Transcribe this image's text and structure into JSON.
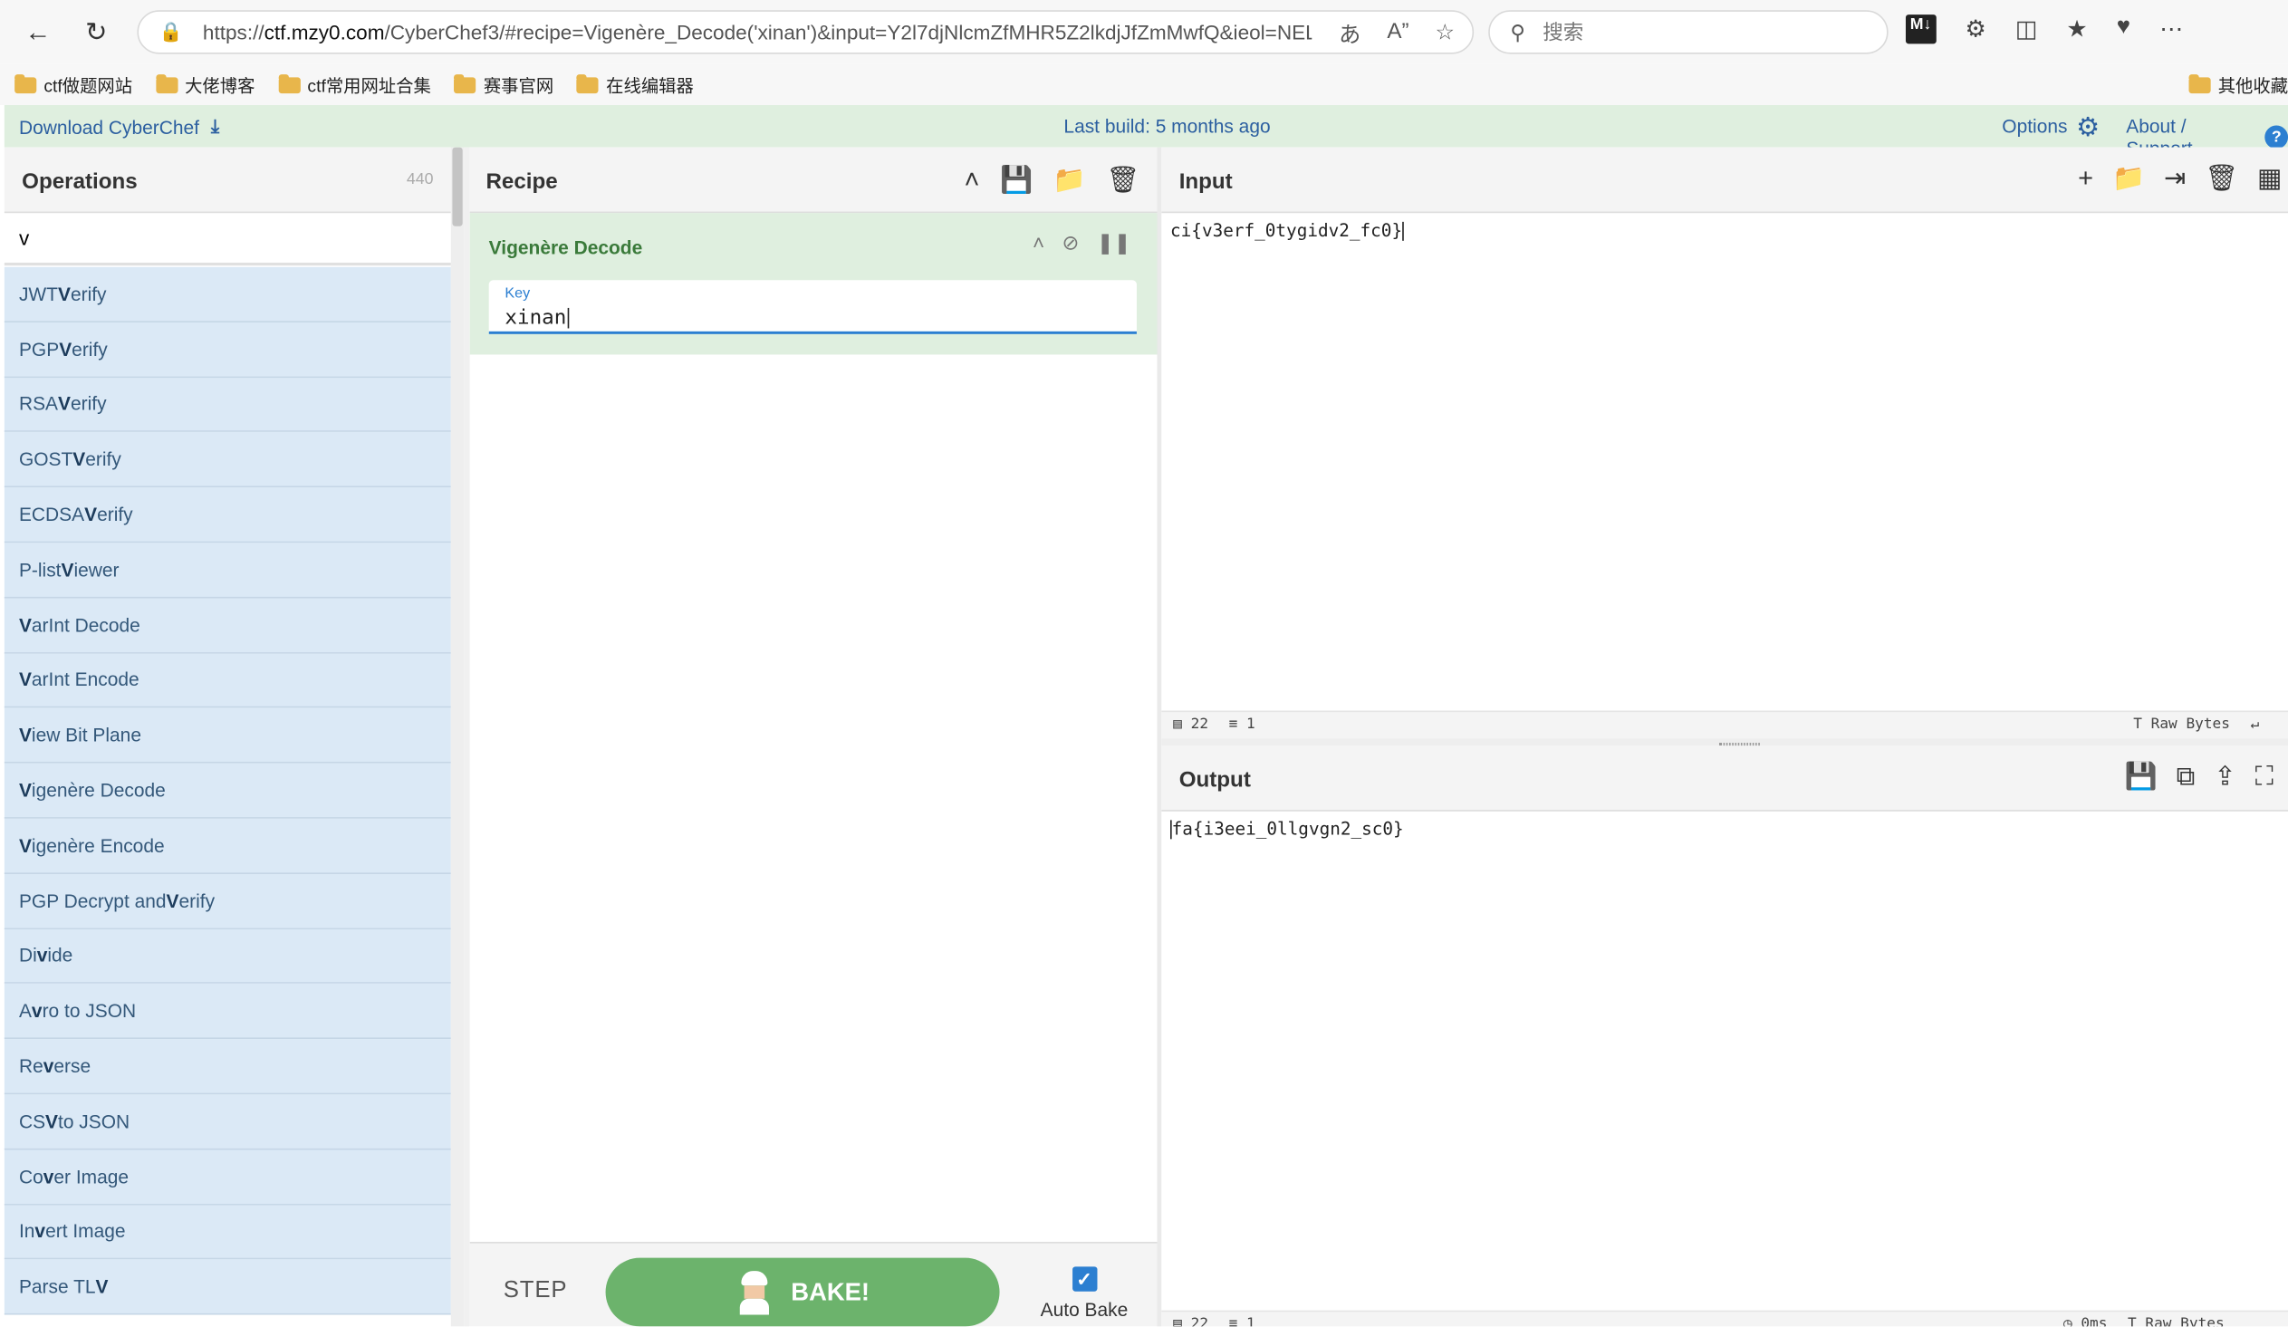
{
  "browser": {
    "url_prefix": "https://",
    "url_host": "ctf.mzy0.com",
    "url_rest": "/CyberChef3/#recipe=Vigenère_Decode('xinan')&input=Y2l7djNlcmZfMHR5Z2lkdjJfZmMwfQ&ieol=NEL&oe...",
    "search_placeholder": "搜索",
    "bookmarks": [
      "ctf做题网站",
      "大佬博客",
      "ctf常用网址合集",
      "赛事官网",
      "在线编辑器"
    ],
    "bookmark_right": "其他收藏夹"
  },
  "banner": {
    "download": "Download CyberChef",
    "last_build": "Last build: 5 months ago",
    "options": "Options",
    "about": "About / Support"
  },
  "operations": {
    "title": "Operations",
    "count": "440",
    "search_value": "v",
    "items": [
      {
        "pre": "JWT ",
        "hl": "V",
        "post": "erify"
      },
      {
        "pre": "PGP ",
        "hl": "V",
        "post": "erify"
      },
      {
        "pre": "RSA ",
        "hl": "V",
        "post": "erify"
      },
      {
        "pre": "GOST ",
        "hl": "V",
        "post": "erify"
      },
      {
        "pre": "ECDSA ",
        "hl": "V",
        "post": "erify"
      },
      {
        "pre": "P-list ",
        "hl": "V",
        "post": "iewer"
      },
      {
        "pre": "",
        "hl": "V",
        "post": "arInt Decode"
      },
      {
        "pre": "",
        "hl": "V",
        "post": "arInt Encode"
      },
      {
        "pre": "",
        "hl": "V",
        "post": "iew Bit Plane"
      },
      {
        "pre": "",
        "hl": "V",
        "post": "igenère Decode"
      },
      {
        "pre": "",
        "hl": "V",
        "post": "igenère Encode"
      },
      {
        "pre": "PGP Decrypt and ",
        "hl": "V",
        "post": "erify"
      },
      {
        "pre": "Di",
        "hl": "v",
        "post": "ide"
      },
      {
        "pre": "A",
        "hl": "v",
        "post": "ro to JSON"
      },
      {
        "pre": "Re",
        "hl": "v",
        "post": "erse"
      },
      {
        "pre": "CS",
        "hl": "V",
        "post": " to JSON"
      },
      {
        "pre": "Co",
        "hl": "v",
        "post": "er Image"
      },
      {
        "pre": "In",
        "hl": "v",
        "post": "ert Image"
      },
      {
        "pre": "Parse TL",
        "hl": "V",
        "post": ""
      }
    ]
  },
  "recipe": {
    "title": "Recipe",
    "ingredient_name": "Vigenère Decode",
    "key_label": "Key",
    "key_value": "xinan",
    "step_label": "STEP",
    "bake_label": "BAKE!",
    "auto_bake_label": "Auto Bake",
    "auto_bake_checked": true
  },
  "input": {
    "title": "Input",
    "text": "ci{v3erf_0tygidv2_fc0}",
    "length": "22",
    "lines": "1",
    "encoding": "Raw Bytes"
  },
  "output": {
    "title": "Output",
    "text": "fa{i3eei_0llgvgn2_sc0}",
    "length": "22",
    "lines": "1",
    "time": "0ms",
    "encoding": "Raw Bytes"
  },
  "colors": {
    "banner_bg": "#dfefdf",
    "op_bg": "#dbe9f6",
    "link": "#2c5fa0",
    "bake_green": "#6cb36c",
    "accent_blue": "#2c7fd1"
  }
}
